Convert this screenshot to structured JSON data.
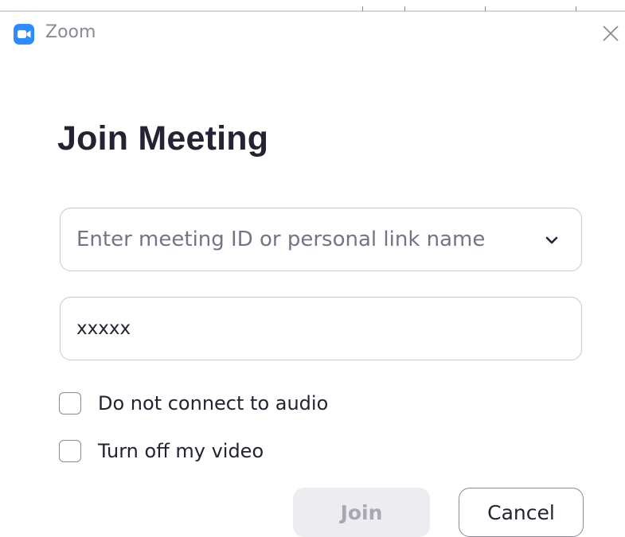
{
  "window": {
    "app_title": "Zoom",
    "app_icon": "video-camera-icon",
    "close_icon": "close-icon"
  },
  "heading": "Join Meeting",
  "meeting_id_field": {
    "placeholder": "Enter meeting ID or personal link name",
    "value": "",
    "dropdown_icon": "chevron-down-icon"
  },
  "name_field": {
    "value": "xxxxx"
  },
  "options": [
    {
      "label": "Do not connect to audio",
      "checked": false
    },
    {
      "label": "Turn off my video",
      "checked": false
    }
  ],
  "buttons": {
    "join_label": "Join",
    "cancel_label": "Cancel"
  },
  "colors": {
    "brand": "#2d8cff",
    "text": "#232333",
    "disabled_button_bg": "#ececf1",
    "disabled_button_text": "#a7a7b5"
  }
}
